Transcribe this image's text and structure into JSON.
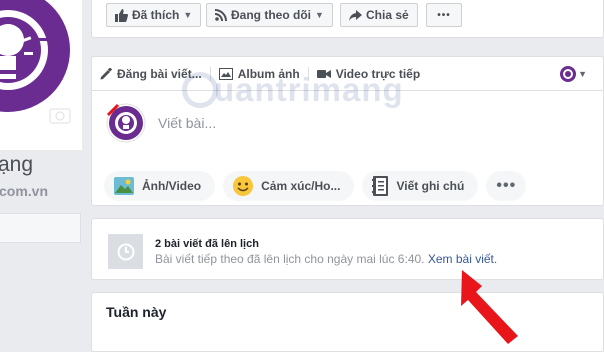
{
  "profile": {
    "name_fragment": "ạng",
    "url_fragment": "com.vn"
  },
  "top_bar": {
    "like_label": "Đã thích",
    "follow_label": "Đang theo dõi",
    "share_label": "Chia sẻ",
    "more_label": "•••"
  },
  "composer": {
    "tabs": [
      {
        "label": "Đăng bài viết..."
      },
      {
        "label": "Album ảnh"
      },
      {
        "label": "Video trực tiếp"
      }
    ],
    "placeholder": "Viết bài...",
    "actions": [
      {
        "label": "Ảnh/Video"
      },
      {
        "label": "Cảm xúc/Ho..."
      },
      {
        "label": "Viết ghi chú"
      }
    ],
    "more_label": "•••"
  },
  "watermark": {
    "text": "uantrimang"
  },
  "scheduled": {
    "title": "2 bài viết đã lên lịch",
    "description": "Bài viết tiếp theo đã lên lịch cho ngày mai lúc 6:40.",
    "link": "Xem bài viết."
  },
  "week": {
    "title": "Tuần này"
  },
  "colors": {
    "accent": "#365899",
    "brand_purple": "#6a2c91",
    "arrow_red": "#e8151b"
  }
}
